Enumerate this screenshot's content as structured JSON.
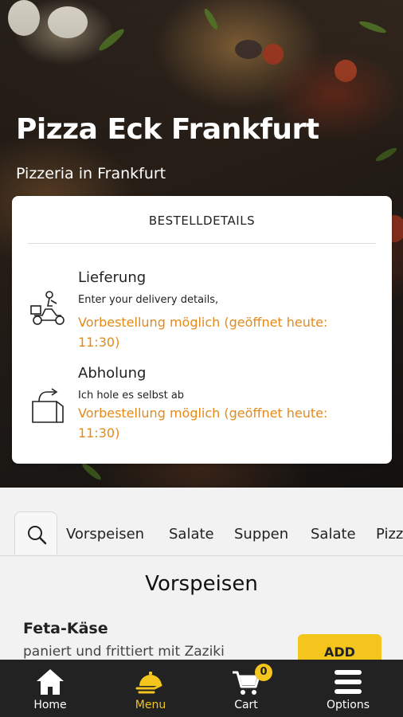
{
  "header": {
    "title": "Pizza Eck Frankfurt",
    "subtitle": "Pizzeria in Frankfurt"
  },
  "order_card": {
    "heading": "BESTELLDETAILS",
    "options": [
      {
        "title": "Lieferung",
        "description": "Enter your delivery details,",
        "note": "Vorbestellung möglich (geöffnet heute: 11:30)",
        "icon": "delivery-scooter-icon"
      },
      {
        "title": "Abholung",
        "description": "Ich hole es selbst ab",
        "note": "Vorbestellung möglich (geöffnet heute: 11:30)",
        "icon": "takeaway-bag-icon"
      }
    ]
  },
  "categories": {
    "search_icon": "search-icon",
    "items": [
      "Vorspeisen",
      "Salate",
      "Suppen",
      "Salate",
      "Pizz"
    ]
  },
  "menu": {
    "section_title": "Vorspeisen",
    "items": [
      {
        "name": "Feta-Käse",
        "description": "paniert und frittiert mit Zaziki",
        "button": "ADD"
      }
    ]
  },
  "tabbar": {
    "tabs": [
      {
        "label": "Home",
        "icon": "home-icon",
        "active": false
      },
      {
        "label": "Menu",
        "icon": "menu-cloche-icon",
        "active": true
      },
      {
        "label": "Cart",
        "icon": "cart-icon",
        "active": false,
        "badge": "0"
      },
      {
        "label": "Options",
        "icon": "hamburger-icon",
        "active": false
      }
    ]
  },
  "colors": {
    "accent": "#f4c51c",
    "note": "#e48a1a",
    "tabbar": "#222222"
  }
}
